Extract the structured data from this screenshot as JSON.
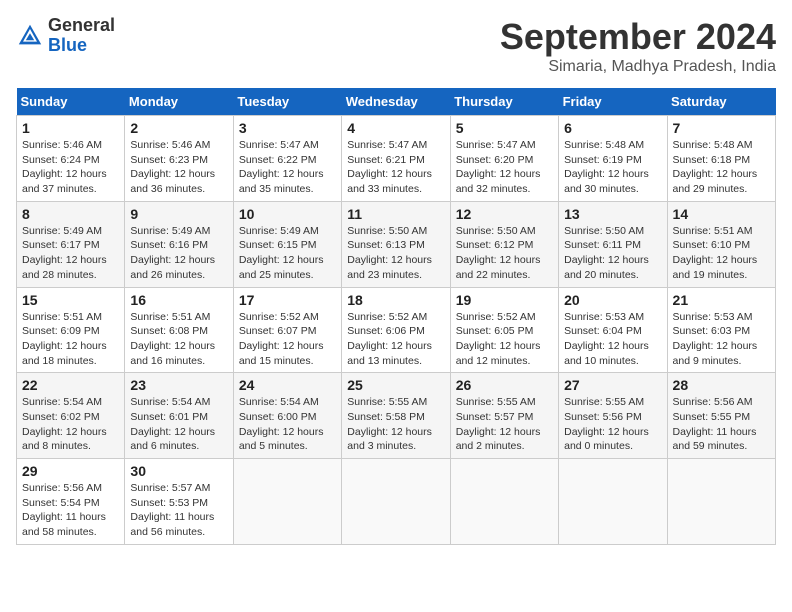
{
  "header": {
    "logo_general": "General",
    "logo_blue": "Blue",
    "month": "September 2024",
    "location": "Simaria, Madhya Pradesh, India"
  },
  "weekdays": [
    "Sunday",
    "Monday",
    "Tuesday",
    "Wednesday",
    "Thursday",
    "Friday",
    "Saturday"
  ],
  "weeks": [
    [
      {
        "day": "1",
        "info": "Sunrise: 5:46 AM\nSunset: 6:24 PM\nDaylight: 12 hours\nand 37 minutes."
      },
      {
        "day": "2",
        "info": "Sunrise: 5:46 AM\nSunset: 6:23 PM\nDaylight: 12 hours\nand 36 minutes."
      },
      {
        "day": "3",
        "info": "Sunrise: 5:47 AM\nSunset: 6:22 PM\nDaylight: 12 hours\nand 35 minutes."
      },
      {
        "day": "4",
        "info": "Sunrise: 5:47 AM\nSunset: 6:21 PM\nDaylight: 12 hours\nand 33 minutes."
      },
      {
        "day": "5",
        "info": "Sunrise: 5:47 AM\nSunset: 6:20 PM\nDaylight: 12 hours\nand 32 minutes."
      },
      {
        "day": "6",
        "info": "Sunrise: 5:48 AM\nSunset: 6:19 PM\nDaylight: 12 hours\nand 30 minutes."
      },
      {
        "day": "7",
        "info": "Sunrise: 5:48 AM\nSunset: 6:18 PM\nDaylight: 12 hours\nand 29 minutes."
      }
    ],
    [
      {
        "day": "8",
        "info": "Sunrise: 5:49 AM\nSunset: 6:17 PM\nDaylight: 12 hours\nand 28 minutes."
      },
      {
        "day": "9",
        "info": "Sunrise: 5:49 AM\nSunset: 6:16 PM\nDaylight: 12 hours\nand 26 minutes."
      },
      {
        "day": "10",
        "info": "Sunrise: 5:49 AM\nSunset: 6:15 PM\nDaylight: 12 hours\nand 25 minutes."
      },
      {
        "day": "11",
        "info": "Sunrise: 5:50 AM\nSunset: 6:13 PM\nDaylight: 12 hours\nand 23 minutes."
      },
      {
        "day": "12",
        "info": "Sunrise: 5:50 AM\nSunset: 6:12 PM\nDaylight: 12 hours\nand 22 minutes."
      },
      {
        "day": "13",
        "info": "Sunrise: 5:50 AM\nSunset: 6:11 PM\nDaylight: 12 hours\nand 20 minutes."
      },
      {
        "day": "14",
        "info": "Sunrise: 5:51 AM\nSunset: 6:10 PM\nDaylight: 12 hours\nand 19 minutes."
      }
    ],
    [
      {
        "day": "15",
        "info": "Sunrise: 5:51 AM\nSunset: 6:09 PM\nDaylight: 12 hours\nand 18 minutes."
      },
      {
        "day": "16",
        "info": "Sunrise: 5:51 AM\nSunset: 6:08 PM\nDaylight: 12 hours\nand 16 minutes."
      },
      {
        "day": "17",
        "info": "Sunrise: 5:52 AM\nSunset: 6:07 PM\nDaylight: 12 hours\nand 15 minutes."
      },
      {
        "day": "18",
        "info": "Sunrise: 5:52 AM\nSunset: 6:06 PM\nDaylight: 12 hours\nand 13 minutes."
      },
      {
        "day": "19",
        "info": "Sunrise: 5:52 AM\nSunset: 6:05 PM\nDaylight: 12 hours\nand 12 minutes."
      },
      {
        "day": "20",
        "info": "Sunrise: 5:53 AM\nSunset: 6:04 PM\nDaylight: 12 hours\nand 10 minutes."
      },
      {
        "day": "21",
        "info": "Sunrise: 5:53 AM\nSunset: 6:03 PM\nDaylight: 12 hours\nand 9 minutes."
      }
    ],
    [
      {
        "day": "22",
        "info": "Sunrise: 5:54 AM\nSunset: 6:02 PM\nDaylight: 12 hours\nand 8 minutes."
      },
      {
        "day": "23",
        "info": "Sunrise: 5:54 AM\nSunset: 6:01 PM\nDaylight: 12 hours\nand 6 minutes."
      },
      {
        "day": "24",
        "info": "Sunrise: 5:54 AM\nSunset: 6:00 PM\nDaylight: 12 hours\nand 5 minutes."
      },
      {
        "day": "25",
        "info": "Sunrise: 5:55 AM\nSunset: 5:58 PM\nDaylight: 12 hours\nand 3 minutes."
      },
      {
        "day": "26",
        "info": "Sunrise: 5:55 AM\nSunset: 5:57 PM\nDaylight: 12 hours\nand 2 minutes."
      },
      {
        "day": "27",
        "info": "Sunrise: 5:55 AM\nSunset: 5:56 PM\nDaylight: 12 hours\nand 0 minutes."
      },
      {
        "day": "28",
        "info": "Sunrise: 5:56 AM\nSunset: 5:55 PM\nDaylight: 11 hours\nand 59 minutes."
      }
    ],
    [
      {
        "day": "29",
        "info": "Sunrise: 5:56 AM\nSunset: 5:54 PM\nDaylight: 11 hours\nand 58 minutes."
      },
      {
        "day": "30",
        "info": "Sunrise: 5:57 AM\nSunset: 5:53 PM\nDaylight: 11 hours\nand 56 minutes."
      },
      {
        "day": "",
        "info": ""
      },
      {
        "day": "",
        "info": ""
      },
      {
        "day": "",
        "info": ""
      },
      {
        "day": "",
        "info": ""
      },
      {
        "day": "",
        "info": ""
      }
    ]
  ]
}
